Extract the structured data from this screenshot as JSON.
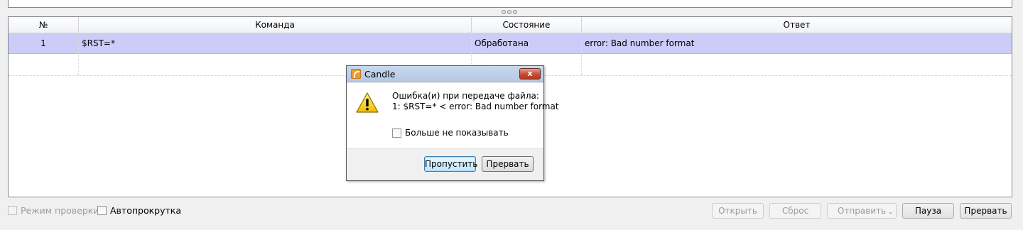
{
  "table": {
    "headers": [
      "№",
      "Команда",
      "Состояние",
      "Ответ"
    ],
    "rows": [
      {
        "num": "1",
        "command": "$RST=*",
        "state": "Обработана",
        "response": "error: Bad number format"
      }
    ]
  },
  "bottom": {
    "check_mode_label": "Режим проверки",
    "autoscroll_label": "Автопрокрутка",
    "open_label": "Открыть",
    "reset_label": "Сброс",
    "send_label": "Отправить",
    "pause_label": "Пауза",
    "abort_label": "Прервать"
  },
  "dialog": {
    "title": "Candle",
    "close_label": "x",
    "message_line1": "Ошибка(и) при передаче файла:",
    "message_line2": "1: $RST=* < error: Bad number format",
    "dont_show_label": "Больше не показывать",
    "skip_label": "Пропустить",
    "abort_label": "Прервать"
  },
  "icons": {
    "warning": "warning-icon",
    "app": "candle-app-icon",
    "close": "close-icon",
    "splitter": "splitter-handle-icon"
  },
  "colors": {
    "selection": "#ccccf9",
    "warning_fill": "#f7d000",
    "close_button": "#c54a32"
  }
}
